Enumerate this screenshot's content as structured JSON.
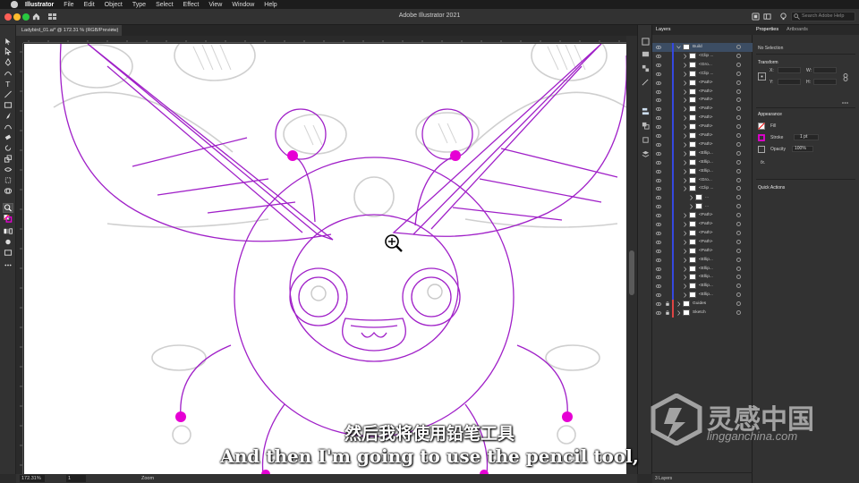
{
  "os_menu": {
    "app_name": "Illustrator",
    "items": [
      "File",
      "Edit",
      "Object",
      "Type",
      "Select",
      "Effect",
      "View",
      "Window",
      "Help"
    ]
  },
  "app_bar": {
    "title": "Adobe Illustrator 2021",
    "search_placeholder": "Search Adobe Help"
  },
  "document": {
    "tab_title": "Ladybird_01.ai* @ 172.31 % (RGB/Preview)",
    "tab_close": "×"
  },
  "rulers": {
    "top_ticks": [
      "260",
      "240",
      "220",
      "200",
      "180",
      "160",
      "140",
      "120",
      "100",
      "80",
      "60",
      "40",
      "20",
      "0",
      "20",
      "40",
      "60",
      "80",
      "100",
      "120",
      "140",
      "160",
      "180",
      "200",
      "220",
      "240",
      "260",
      "280",
      "300",
      "320",
      "340"
    ]
  },
  "status_bar": {
    "zoom": "172.31%",
    "page": "1",
    "tool_label": "Zoom"
  },
  "layers_panel": {
    "tab": "Layers",
    "rows": [
      {
        "name": "Build",
        "level": 0,
        "expanded": true,
        "selected": true
      },
      {
        "name": "<Clip ...",
        "level": 1
      },
      {
        "name": "<Gro...",
        "level": 1
      },
      {
        "name": "<Clip ...",
        "level": 1
      },
      {
        "name": "<Path>",
        "level": 1
      },
      {
        "name": "<Path>",
        "level": 1
      },
      {
        "name": "<Path>",
        "level": 1
      },
      {
        "name": "<Path>",
        "level": 1
      },
      {
        "name": "<Path>",
        "level": 1
      },
      {
        "name": "<Path>",
        "level": 1
      },
      {
        "name": "<Path>",
        "level": 1
      },
      {
        "name": "<Path>",
        "level": 1
      },
      {
        "name": "<Ellip...",
        "level": 1
      },
      {
        "name": "<Ellip...",
        "level": 1
      },
      {
        "name": "<Ellip...",
        "level": 1
      },
      {
        "name": "<Gro...",
        "level": 1
      },
      {
        "name": "<Clip ...",
        "level": 1
      },
      {
        "name": "...",
        "level": 2
      },
      {
        "name": "...",
        "level": 2
      },
      {
        "name": "<Path>",
        "level": 1
      },
      {
        "name": "<Path>",
        "level": 1
      },
      {
        "name": "<Path>",
        "level": 1
      },
      {
        "name": "<Path>",
        "level": 1
      },
      {
        "name": "<Path>",
        "level": 1
      },
      {
        "name": "<Ellip...",
        "level": 1
      },
      {
        "name": "<Ellip...",
        "level": 1
      },
      {
        "name": "<Ellip...",
        "level": 1
      },
      {
        "name": "<Ellip...",
        "level": 1
      },
      {
        "name": "<Ellip...",
        "level": 1
      },
      {
        "name": "Guides",
        "level": 0
      },
      {
        "name": "Sketch",
        "level": 0
      }
    ],
    "footer": "3 Layers"
  },
  "properties_panel": {
    "tab_active": "Properties",
    "tab_other": "Artboards",
    "selection": "No Selection",
    "transform_header": "Transform",
    "x_label": "X:",
    "y_label": "Y:",
    "w_label": "W:",
    "h_label": "H:",
    "appearance_header": "Appearance",
    "fill_label": "Fill",
    "stroke_label": "Stroke",
    "stroke_value": "1 pt",
    "opacity_label": "Opacity",
    "opacity_value": "100%",
    "fx_label": "fx.",
    "quick_actions_header": "Quick Actions"
  },
  "watermark": {
    "brand": "灵感中国",
    "url": "lingganchina.com"
  },
  "subtitles": {
    "chinese": "然后我将使用铅笔工具",
    "english": "And then I'm going to use the pencil tool,"
  },
  "colors": {
    "artwork_stroke": "#a020c8",
    "artwork_dot": "#e600d4",
    "sketch_gray": "#c8c8c8",
    "layer_color": "#3548e0"
  }
}
